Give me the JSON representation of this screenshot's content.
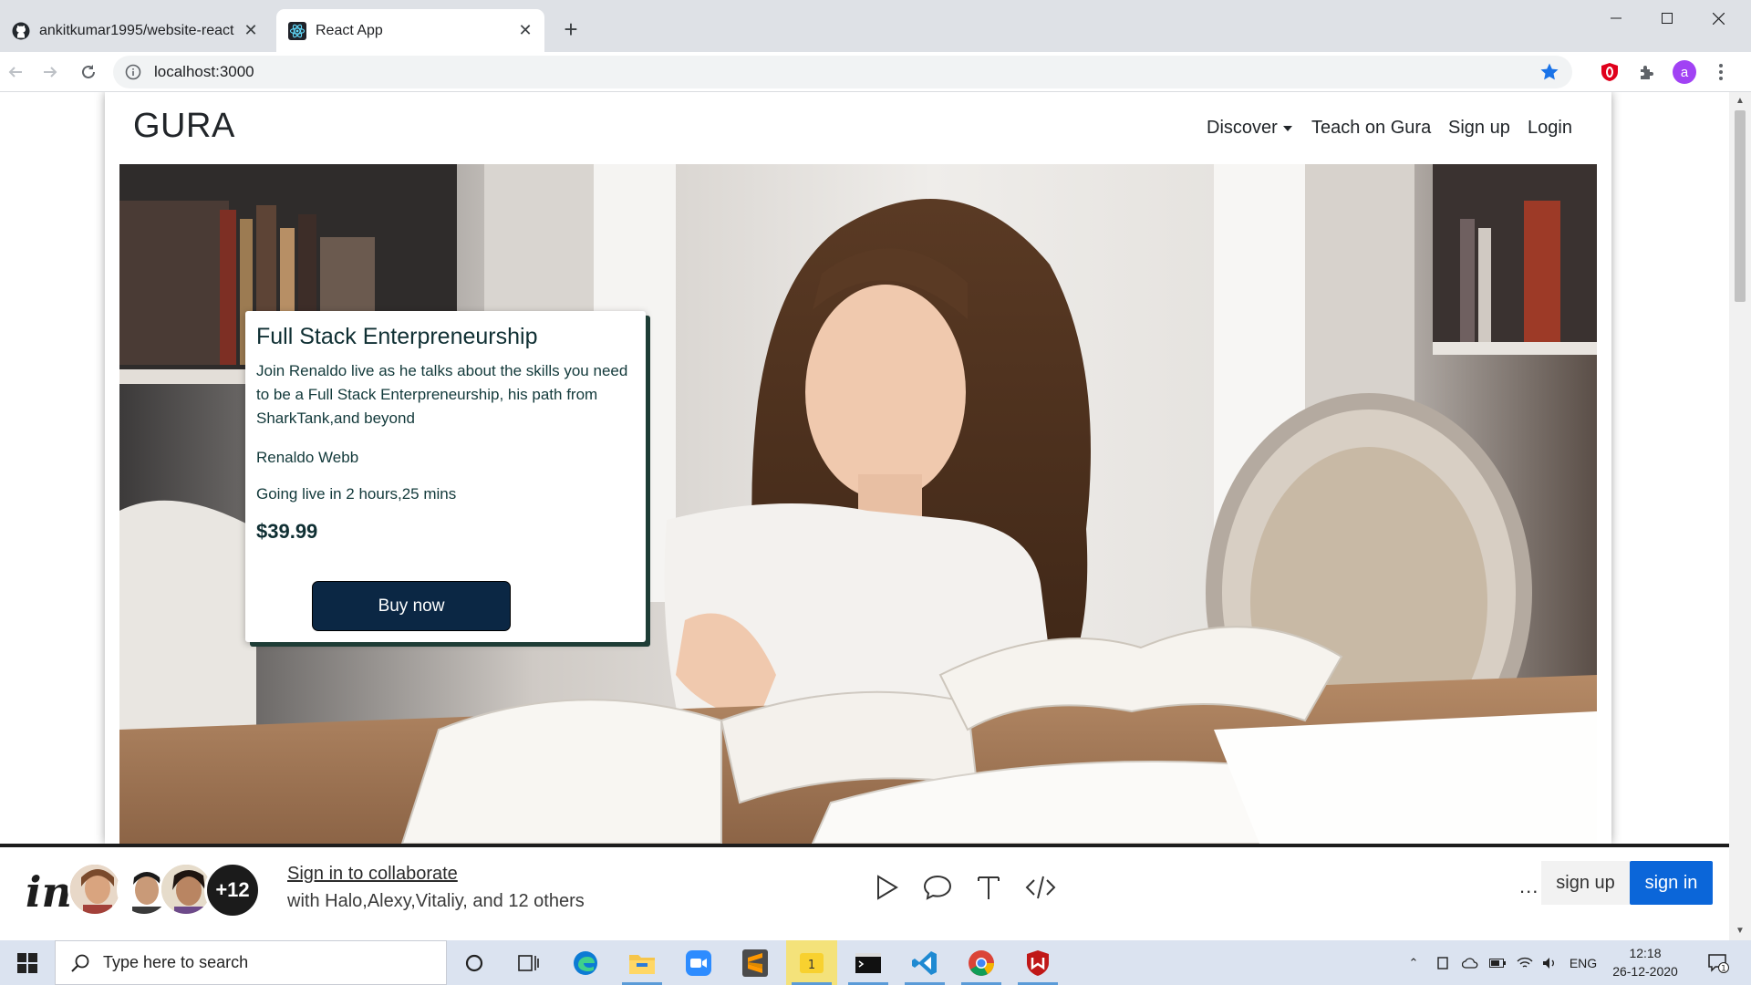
{
  "browser": {
    "tabs": [
      {
        "title": "ankitkumar1995/website-react",
        "favicon": "github-icon",
        "active": false
      },
      {
        "title": "React App",
        "favicon": "react-icon",
        "active": true
      }
    ],
    "url": "localhost:3000",
    "profile_initial": "a"
  },
  "site": {
    "brand": "GURA",
    "nav": {
      "discover": "Discover",
      "teach": "Teach on Gura",
      "signup": "Sign up",
      "login": "Login"
    }
  },
  "course_card": {
    "title": "Full Stack Enterpreneurship",
    "description": "Join Renaldo live as he talks about the skills you need to be a Full Stack Enterpreneurship, his path from SharkTank,and beyond",
    "author": "Renaldo Webb",
    "live_status": "Going live in 2 hours,25 mins",
    "price": "$39.99",
    "buy_label": "Buy now"
  },
  "collab_bar": {
    "logo": "in",
    "extra_count": "+12",
    "signin_link": "Sign in to collaborate",
    "with_text": "with Halo,Alexy,Vitaliy, and 12 others",
    "more": "...",
    "signup": "sign up",
    "signin": "sign in"
  },
  "taskbar": {
    "search_placeholder": "Type here to search",
    "language": "ENG",
    "time": "12:18",
    "date": "26-12-2020",
    "notification_count": "1"
  },
  "colors": {
    "buy_button": "#0b2744",
    "signin_button": "#0b66d9",
    "taskbar": "#dbe3f0"
  }
}
